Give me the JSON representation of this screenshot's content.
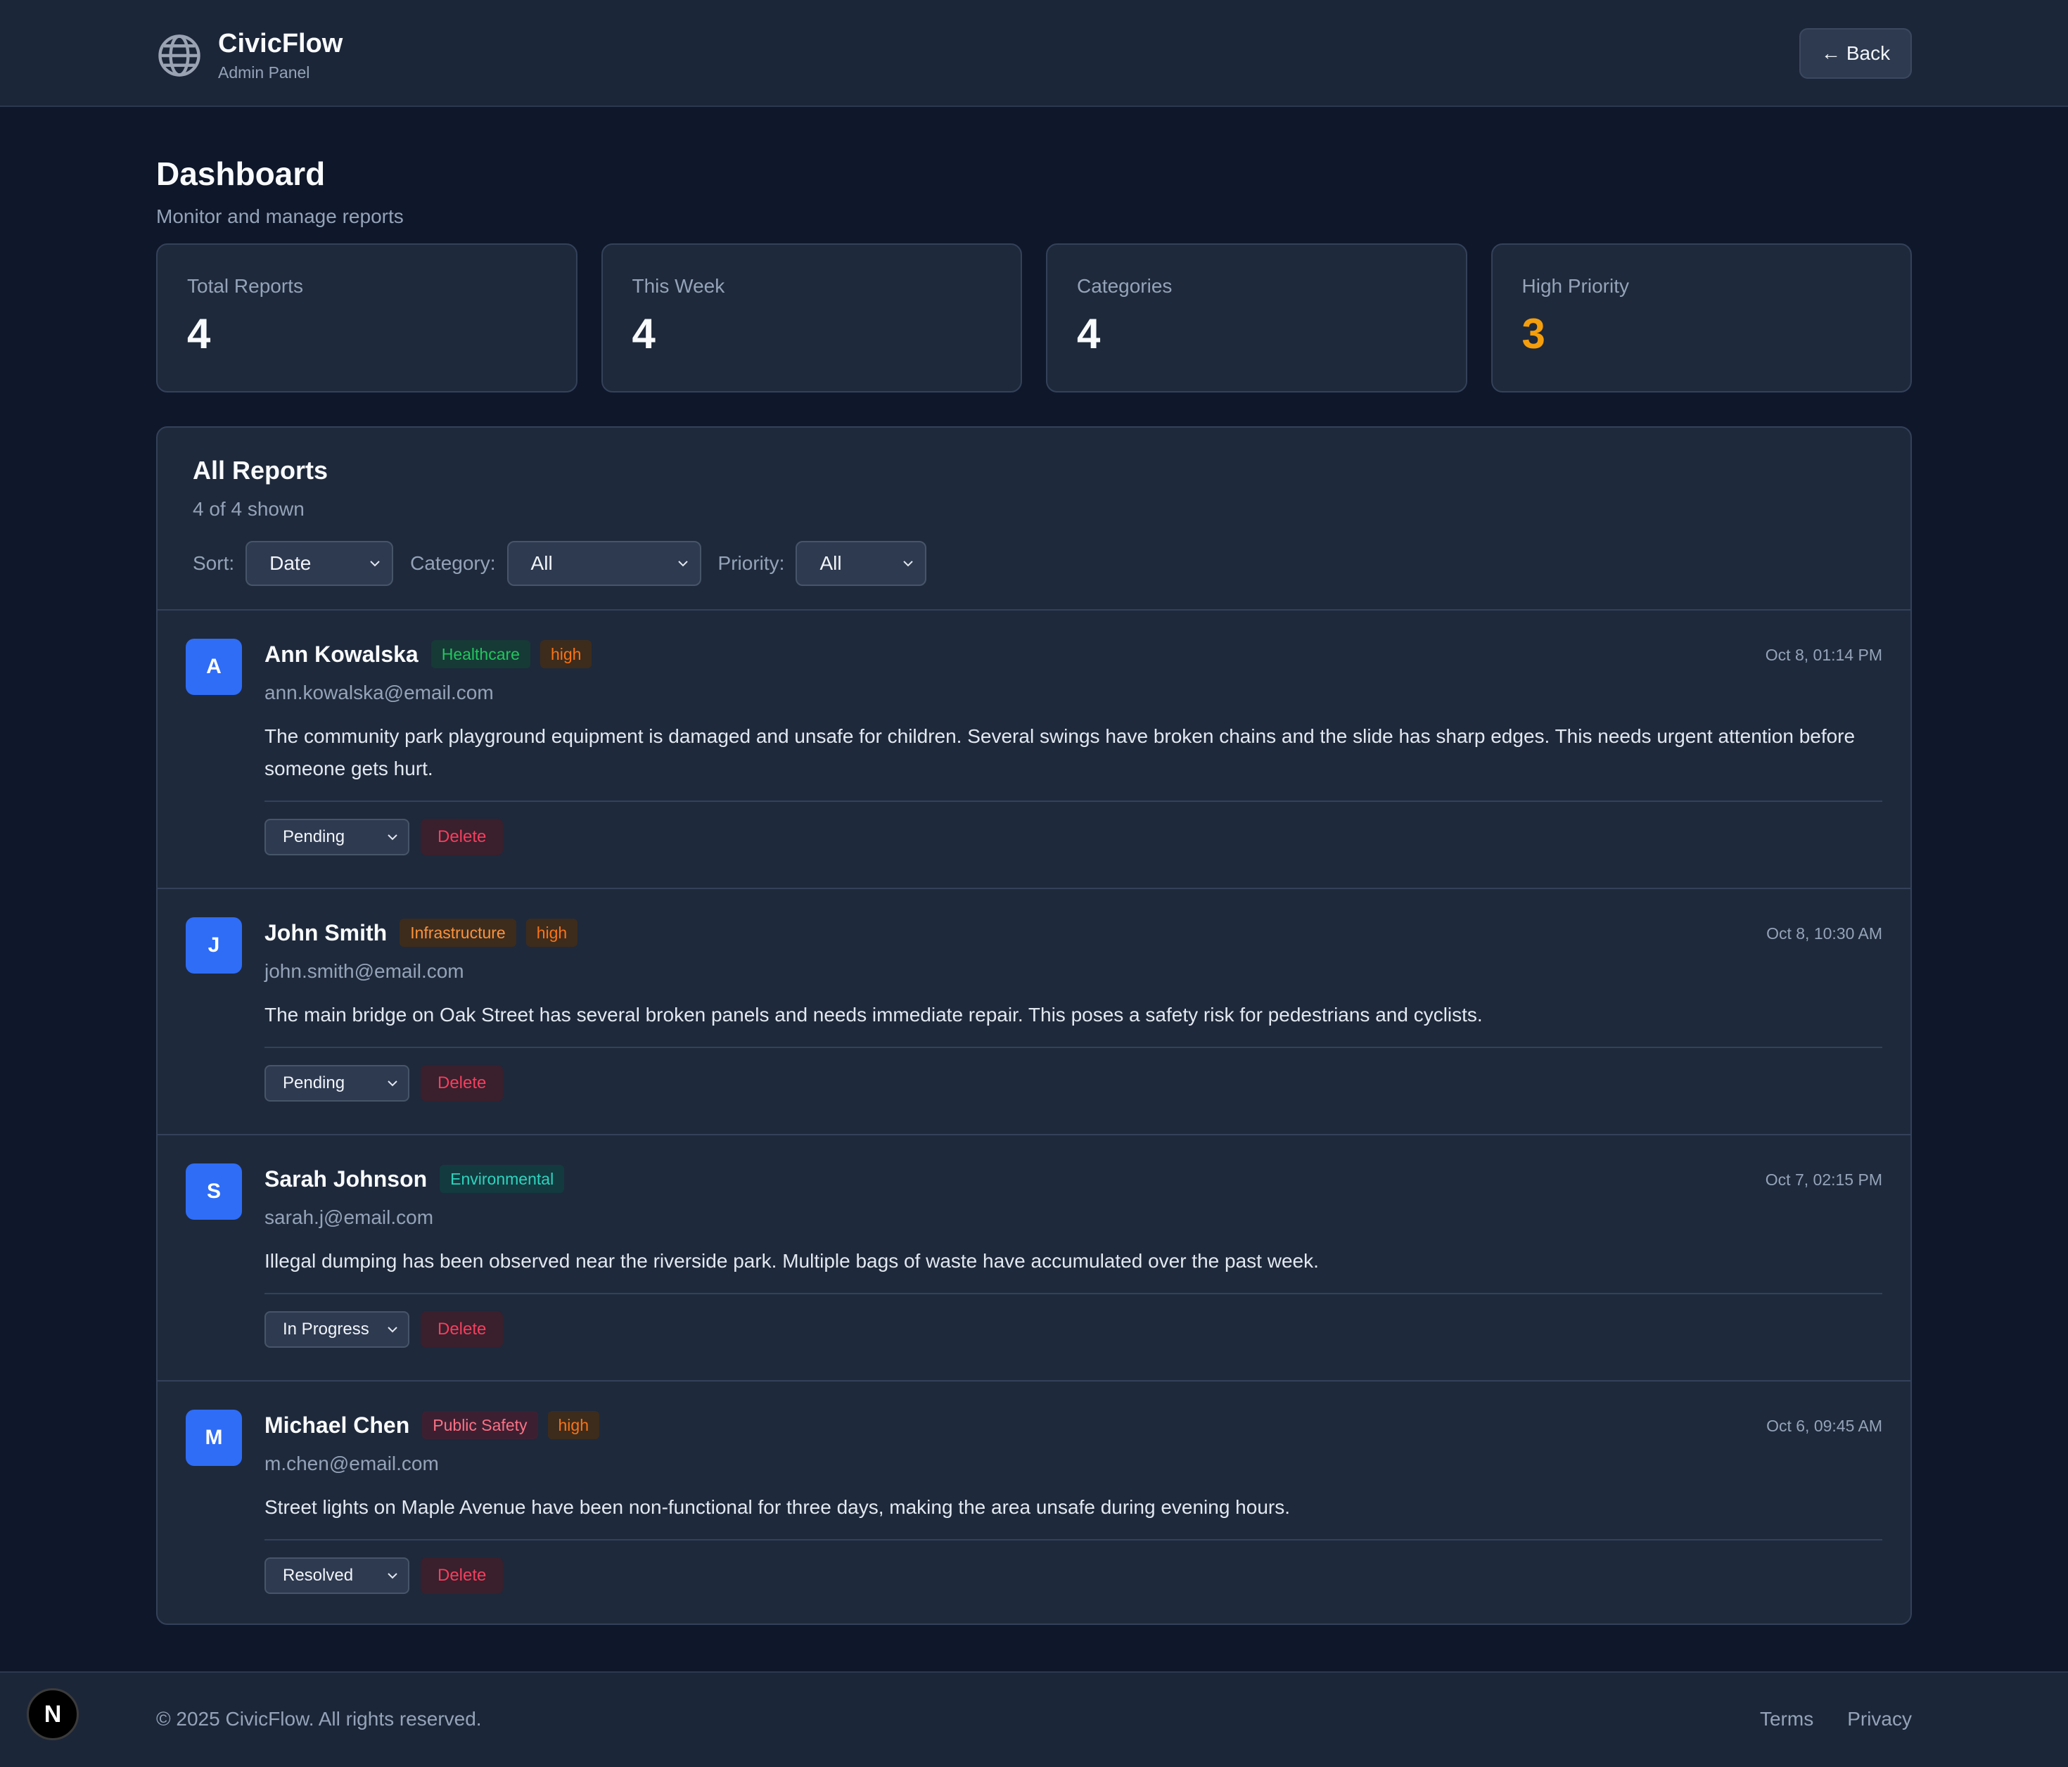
{
  "header": {
    "app_name": "CivicFlow",
    "app_subtitle": "Admin Panel",
    "back_label": "Back",
    "logo_icon": "globe-icon"
  },
  "page": {
    "title": "Dashboard",
    "subtitle": "Monitor and manage reports"
  },
  "stats": [
    {
      "label": "Total Reports",
      "value": "4"
    },
    {
      "label": "This Week",
      "value": "4"
    },
    {
      "label": "Categories",
      "value": "4"
    },
    {
      "label": "High Priority",
      "value": "3"
    }
  ],
  "reports_panel": {
    "title": "All Reports",
    "count_text": "4 of 4 shown",
    "filters": {
      "sort_label": "Sort:",
      "sort_value": "Date",
      "category_label": "Category:",
      "category_value": "All",
      "priority_label": "Priority:",
      "priority_value": "All"
    }
  },
  "reports": [
    {
      "initial": "A",
      "name": "Ann Kowalska",
      "category": "Healthcare",
      "priority": "high",
      "date": "Oct 8, 01:14 PM",
      "email": "ann.kowalska@email.com",
      "description": "The community park playground equipment is damaged and unsafe for children. Several swings have broken chains and the slide has sharp edges. This needs urgent attention before someone gets hurt.",
      "status": "Pending",
      "delete_label": "Delete"
    },
    {
      "initial": "J",
      "name": "John Smith",
      "category": "Infrastructure",
      "priority": "high",
      "date": "Oct 8, 10:30 AM",
      "email": "john.smith@email.com",
      "description": "The main bridge on Oak Street has several broken panels and needs immediate repair. This poses a safety risk for pedestrians and cyclists.",
      "status": "Pending",
      "delete_label": "Delete"
    },
    {
      "initial": "S",
      "name": "Sarah Johnson",
      "category": "Environmental",
      "priority": "",
      "date": "Oct 7, 02:15 PM",
      "email": "sarah.j@email.com",
      "description": "Illegal dumping has been observed near the riverside park. Multiple bags of waste have accumulated over the past week.",
      "status": "In Progress",
      "delete_label": "Delete"
    },
    {
      "initial": "M",
      "name": "Michael Chen",
      "category": "Public Safety",
      "priority": "high",
      "date": "Oct 6, 09:45 AM",
      "email": "m.chen@email.com",
      "description": "Street lights on Maple Avenue have been non-functional for three days, making the area unsafe during evening hours.",
      "status": "Resolved",
      "delete_label": "Delete"
    }
  ],
  "footer": {
    "copyright": "© 2025 CivicFlow. All rights reserved.",
    "terms": "Terms",
    "privacy": "Privacy",
    "badge_letter": "N"
  },
  "colors": {
    "background": "#0f172a",
    "card": "#1e293b",
    "accent_blue": "#2f6df6",
    "high_priority": "#f59e0b"
  }
}
